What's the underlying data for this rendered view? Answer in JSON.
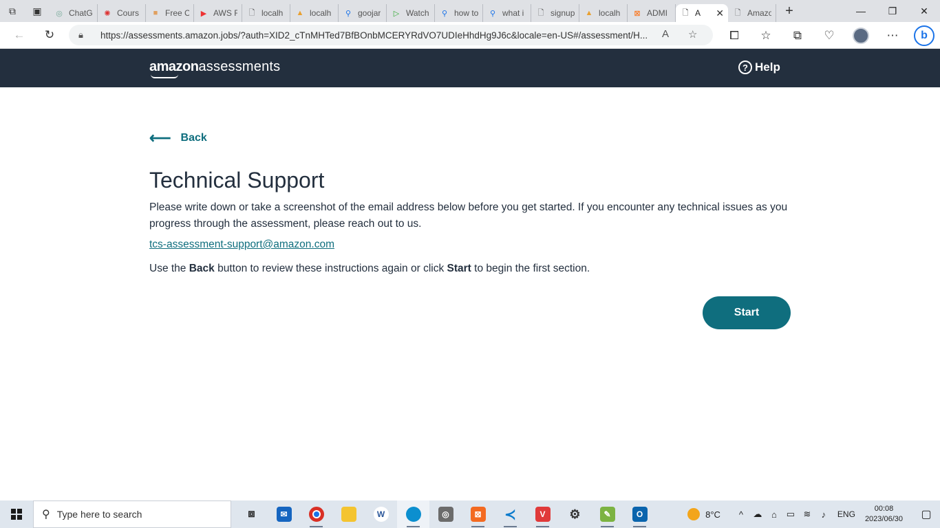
{
  "browser": {
    "tabs": [
      {
        "label": "ChatG",
        "icon": "chatgpt-icon"
      },
      {
        "label": "Cours",
        "icon": "circle-icon"
      },
      {
        "label": "Free C",
        "icon": "box-icon"
      },
      {
        "label": "AWS F",
        "icon": "youtube-icon"
      },
      {
        "label": "localh",
        "icon": "page-icon"
      },
      {
        "label": "localh",
        "icon": "pma-icon"
      },
      {
        "label": "goojar",
        "icon": "search-icon"
      },
      {
        "label": "Watch",
        "icon": "play-icon"
      },
      {
        "label": "how to",
        "icon": "search-icon"
      },
      {
        "label": "what i",
        "icon": "search-icon"
      },
      {
        "label": "signup",
        "icon": "page-icon"
      },
      {
        "label": "localh",
        "icon": "pma-icon"
      },
      {
        "label": "ADMI",
        "icon": "xampp-icon"
      },
      {
        "label": "A",
        "icon": "page-icon",
        "active": true
      },
      {
        "label": "Amazo",
        "icon": "page-icon"
      }
    ],
    "url": "https://assessments.amazon.jobs/?auth=XID2_cTnMHTed7BfBOnbMCERYRdVO7UDIeHhdHg9J6c&locale=en-US#/assessment/H..."
  },
  "header": {
    "logo_bold": "amazon",
    "logo_light": "assessments",
    "help_label": "Help"
  },
  "main": {
    "back_label": "Back",
    "title": "Technical Support",
    "paragraph1": "Please write down or take a screenshot of the email address below before you get started. If you encounter any technical issues as you progress through the assessment, please reach out to us.",
    "support_email": "tcs-assessment-support@amazon.com",
    "paragraph2_prefix": "Use the ",
    "paragraph2_back": "Back",
    "paragraph2_middle": " button to review these instructions again or click ",
    "paragraph2_start": "Start",
    "paragraph2_suffix": " to begin the first section.",
    "start_label": "Start",
    "accent_color": "#0f6e7e"
  },
  "taskbar": {
    "search_placeholder": "Type here to search",
    "temperature": "8°C",
    "language": "ENG",
    "time": "00:08",
    "date": "2023/06/30"
  }
}
